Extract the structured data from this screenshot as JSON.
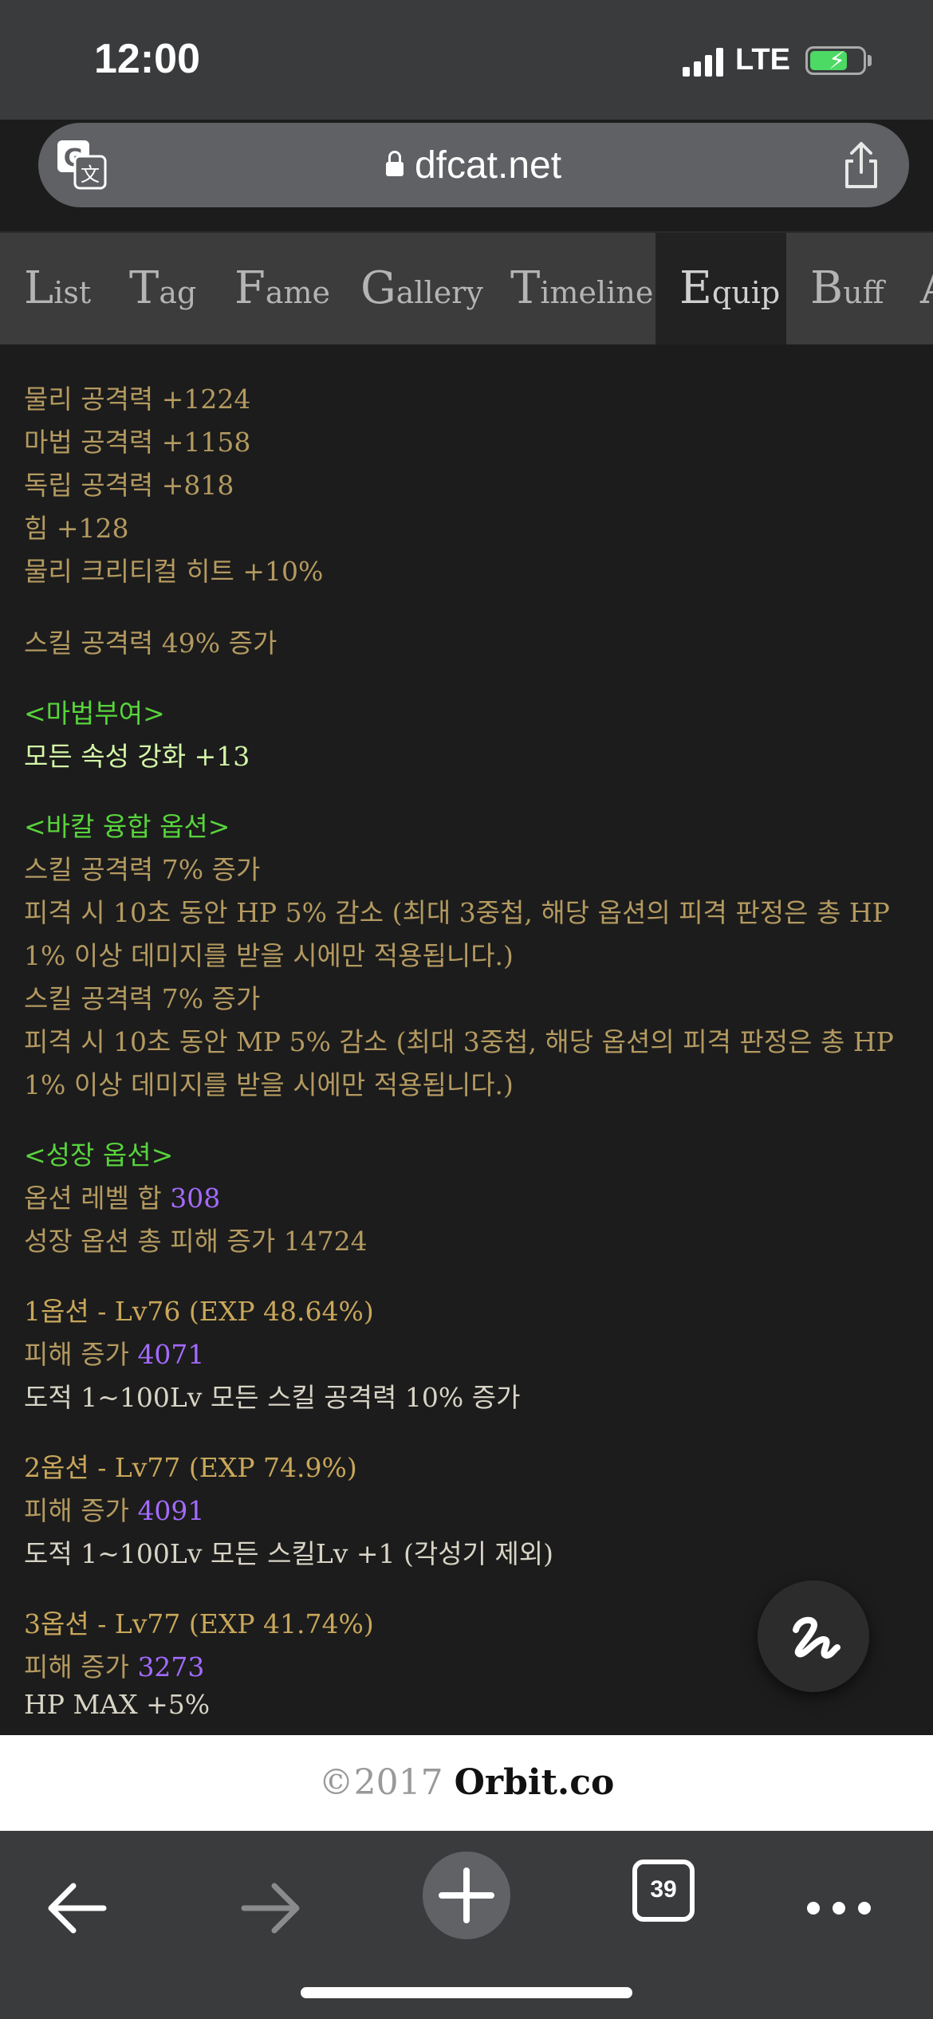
{
  "status_bar": {
    "time": "12:00",
    "network": "LTE",
    "icons": [
      "signal-icon",
      "battery-charging-icon"
    ]
  },
  "browser": {
    "url": "dfcat.net",
    "icons": [
      "translate-icon",
      "lock-icon",
      "share-icon"
    ]
  },
  "tabs": [
    {
      "cap": "L",
      "rest": "ist",
      "active": false
    },
    {
      "cap": "T",
      "rest": "ag",
      "active": false
    },
    {
      "cap": "F",
      "rest": "ame",
      "active": false
    },
    {
      "cap": "G",
      "rest": "allery",
      "active": false
    },
    {
      "cap": "T",
      "rest": "imeline",
      "active": false
    },
    {
      "cap": "E",
      "rest": "quip",
      "active": true
    },
    {
      "cap": "B",
      "rest": "uff",
      "active": false
    },
    {
      "cap": "A",
      "rest": "",
      "active": false
    }
  ],
  "stats": [
    "물리 공격력 +1224",
    "마법 공격력 +1158",
    "독립 공격력 +818",
    "힘 +128",
    "물리 크리티컬 히트 +10%"
  ],
  "skill_attack": "스킬 공격력 49% 증가",
  "enchant": {
    "header": "<마법부여>",
    "value": "모든 속성 강화 +13"
  },
  "bakal": {
    "header": "<바칼 융합 옵션>",
    "lines": [
      "스킬 공격력 7% 증가",
      "피격 시 10초 동안 HP 5% 감소 (최대 3중첩, 해당 옵션의 피격 판정은 총 HP",
      "1% 이상 데미지를 받을 시에만 적용됩니다.)",
      "스킬 공격력 7% 증가",
      "피격 시 10초 동안 MP 5% 감소 (최대 3중첩, 해당 옵션의 피격 판정은 총 HP",
      "1% 이상 데미지를 받을 시에만 적용됩니다.)"
    ]
  },
  "growth": {
    "header": "<성장 옵션>",
    "level_sum_label": "옵션 레벨 합",
    "level_sum_value": "308",
    "total_damage": "성장 옵션 총 피해 증가 14724",
    "options": [
      {
        "title": "1옵션 - Lv76 (EXP 48.64%)",
        "damage_label": "피해 증가",
        "damage_value": "4071",
        "effect": "도적 1~100Lv 모든 스킬 공격력 10% 증가"
      },
      {
        "title": "2옵션 - Lv77 (EXP 74.9%)",
        "damage_label": "피해 증가",
        "damage_value": "4091",
        "effect": "도적 1~100Lv 모든 스킬Lv +1 (각성기 제외)"
      },
      {
        "title": "3옵션 - Lv77 (EXP 41.74%)",
        "damage_label": "피해 증가",
        "damage_value": "3273",
        "effect": "HP MAX +5%"
      }
    ]
  },
  "footer": {
    "copyright": "©2017",
    "brand": "Orbit.co"
  },
  "bottom_toolbar": {
    "tab_count": "39",
    "icons": [
      "back-arrow-icon",
      "forward-arrow-icon",
      "new-tab-plus-icon",
      "tabs-icon",
      "more-icon"
    ]
  },
  "fab": {
    "icon": "scribble-icon"
  },
  "colors": {
    "text_gold": "#b49a60",
    "header_green": "#58d43c",
    "enchant_value": "#d4f7a8",
    "number_purple": "#a36bff",
    "background": "#1c1c1c"
  }
}
